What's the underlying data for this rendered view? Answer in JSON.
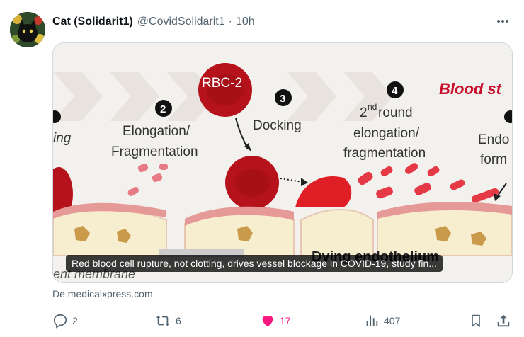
{
  "tweet": {
    "author_name": "Cat (Solidarit1)",
    "handle": "@CovidSolidarit1",
    "separator": "·",
    "time": "10h"
  },
  "card": {
    "title": "Red blood cell rupture, not clotting, drives vessel blockage in COVID-19, study fin...",
    "source": "De medicalxpress.com",
    "figure_text": {
      "stage1_fragment": "ing",
      "stage2_number": "2",
      "stage2_label_1": "Elongation/",
      "stage2_label_2": "Fragmentation",
      "rbc_label": "RBC-2",
      "stage3_number": "3",
      "stage3_label": "Docking",
      "stage4_number": "4",
      "stage4_label_1": "2",
      "stage4_label_sup": "nd",
      "stage4_label_1b": " round",
      "stage4_label_2": "elongation/",
      "stage4_label_3": "fragmentation",
      "blood_label": "Blood st",
      "endo_label_1": "Endo",
      "endo_label_2": "form",
      "bottom_left": "ent membrane",
      "bottom_mid": "Dying endothelium"
    }
  },
  "actions": {
    "replies": "2",
    "reposts": "6",
    "likes": "17",
    "views": "407"
  },
  "colors": {
    "like_active": "#f91880",
    "muted": "#536471",
    "blood_label": "#c8102e"
  }
}
